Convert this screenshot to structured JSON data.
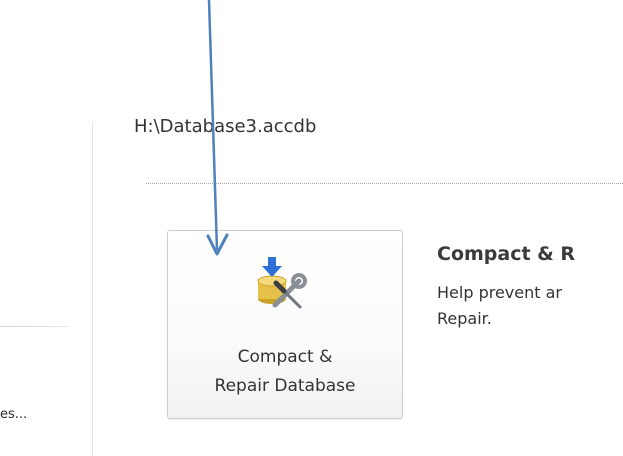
{
  "info": {
    "file_path": "H:\\Database3.accdb"
  },
  "nav": {
    "partial_item_label": "es..."
  },
  "compact_button": {
    "label_line1": "Compact &",
    "label_line2": "Repair Database",
    "icon": "compact-repair-database-icon"
  },
  "description": {
    "title": "Compact & R",
    "line1": "Help prevent ar",
    "line2": "Repair."
  },
  "annotation": {
    "icon": "annotation-arrow",
    "color": "#4f81bd"
  },
  "colors": {
    "text": "#333333",
    "button_border": "#cdcdcd",
    "separator": "#a9a9a9"
  }
}
